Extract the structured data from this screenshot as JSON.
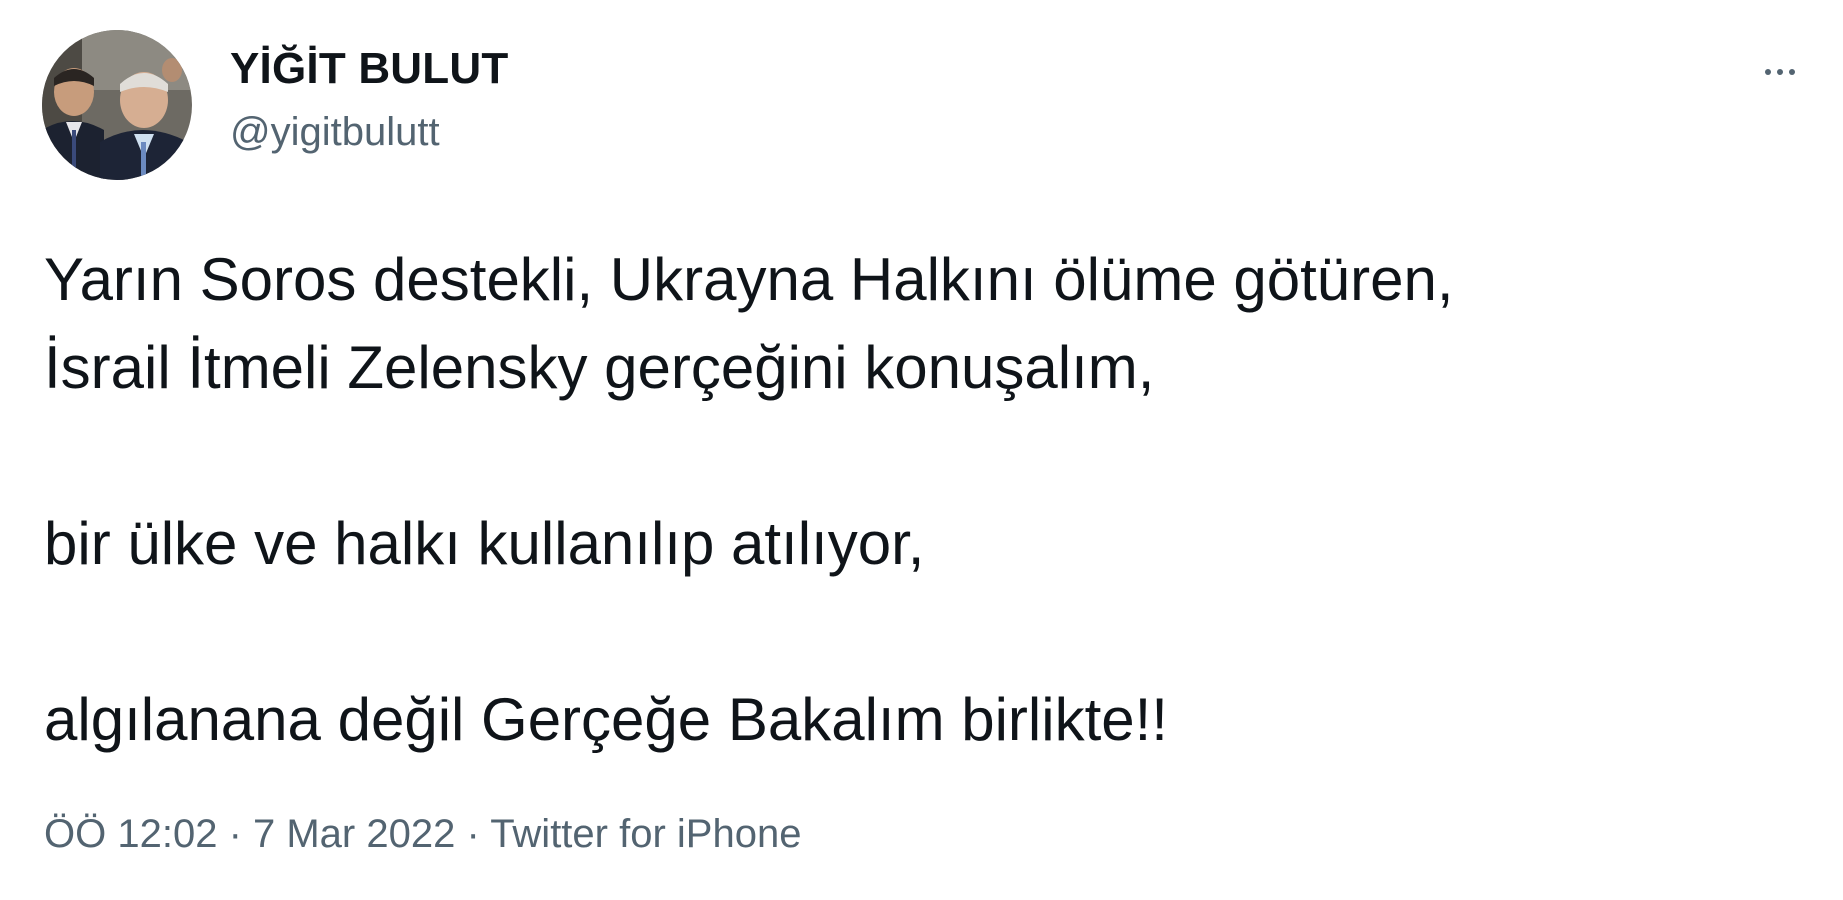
{
  "author": {
    "display_name": "YİĞİT BULUT",
    "handle": "@yigitbulutt",
    "avatar_icon": "profile-photo"
  },
  "more_icon": "ellipsis-icon",
  "tweet": {
    "line1": "Yarın Soros destekli, Ukrayna Halkını ölüme götüren,",
    "line2": "İsrail İtmeli Zelensky gerçeğini konuşalım,",
    "line3": "bir ülke ve halkı kullanılıp atılıyor,",
    "line4": "algılanana değil Gerçeğe Bakalım birlikte!!"
  },
  "meta": {
    "time": "ÖÖ 12:02",
    "separator": "·",
    "date": "7 Mar 2022",
    "source": "Twitter for iPhone"
  },
  "colors": {
    "text_primary": "#0f1419",
    "text_secondary": "#536471",
    "background": "#ffffff"
  }
}
